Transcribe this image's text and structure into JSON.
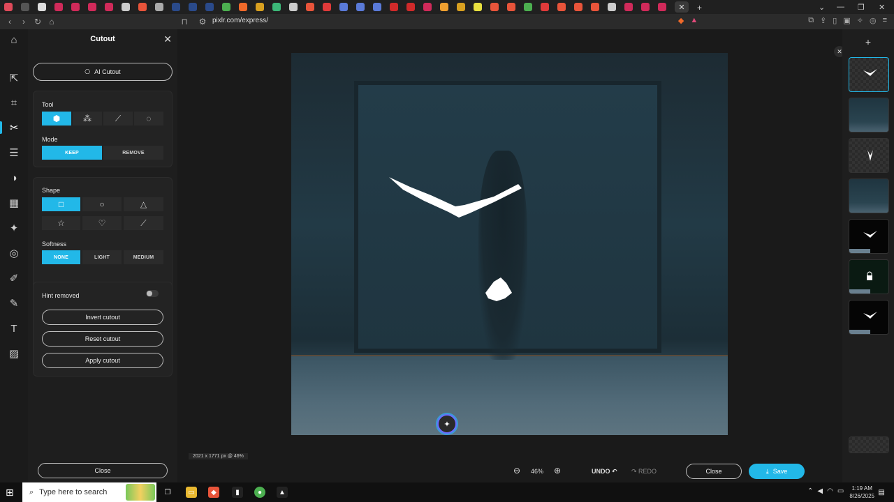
{
  "browser": {
    "url": "pixlr.com/express/",
    "tab_count": 42
  },
  "colors": {
    "accent": "#22b8e8",
    "panel_bg": "#1e1e1e",
    "rail_bg": "#1b1b1b"
  },
  "rail": {
    "items": [
      "home-icon",
      "arrange-icon",
      "crop-icon",
      "cutout-icon",
      "adjust-icon",
      "filter-icon",
      "effect-icon",
      "ai-icon",
      "liquify-icon",
      "heal-icon",
      "draw-icon",
      "text-icon",
      "texture-icon"
    ]
  },
  "panel": {
    "title": "Cutout",
    "ai_cutout": "AI Cutout",
    "tool_label": "Tool",
    "mode_label": "Mode",
    "mode_keep": "KEEP",
    "mode_remove": "REMOVE",
    "shape_label": "Shape",
    "softness_label": "Softness",
    "softness_none": "NONE",
    "softness_light": "LIGHT",
    "softness_medium": "MEDIUM",
    "hint_removed": "Hint removed",
    "invert": "Invert cutout",
    "reset": "Reset cutout",
    "apply": "Apply cutout",
    "close": "Close"
  },
  "canvas": {
    "dims": "2021 x 1771 px @ 46%"
  },
  "bottombar": {
    "zoom": "46%",
    "undo": "UNDO",
    "redo": "REDO",
    "close": "Close",
    "save": "Save"
  },
  "taskbar": {
    "search_placeholder": "Type here to search",
    "time": "1:19 AM",
    "date": "8/26/2025"
  }
}
